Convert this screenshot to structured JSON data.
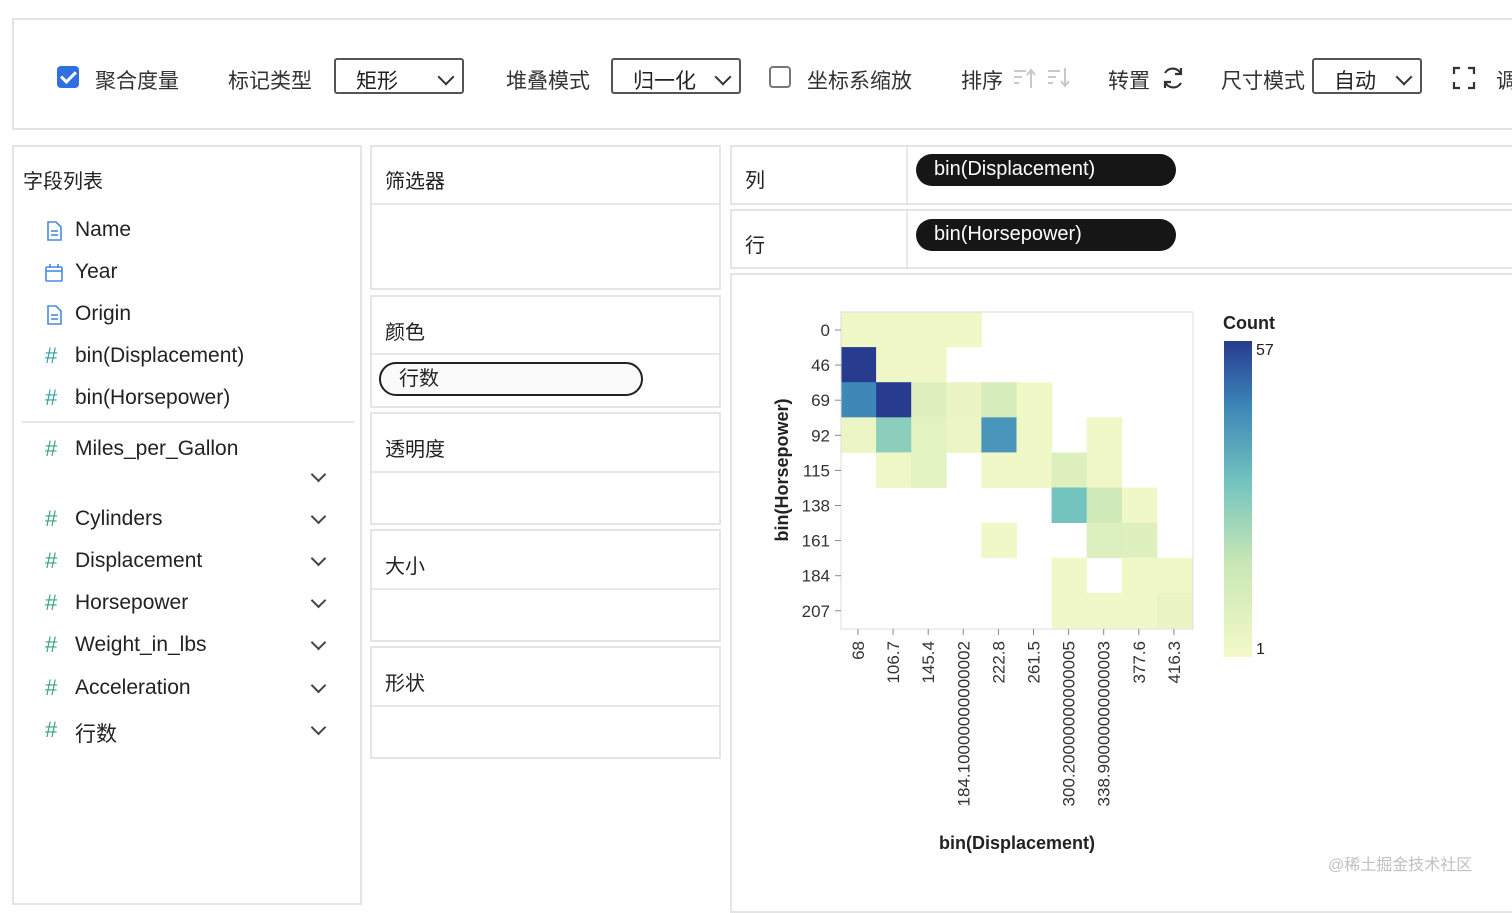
{
  "toolbar": {
    "aggregate_label": "聚合度量",
    "aggregate_checked": true,
    "mark_type_label": "标记类型",
    "mark_type_value": "矩形",
    "stack_label": "堆叠模式",
    "stack_value": "归一化",
    "axis_scale_label": "坐标系缩放",
    "axis_scale_checked": false,
    "sort_label": "排序",
    "transpose_label": "转置",
    "size_mode_label": "尺寸模式",
    "size_mode_value": "自动",
    "cut_label": "调"
  },
  "fields": {
    "title": "字段列表",
    "dimensions": [
      {
        "label": "Name",
        "icon": "file-icon"
      },
      {
        "label": "Year",
        "icon": "calendar-icon"
      },
      {
        "label": "Origin",
        "icon": "file-icon"
      },
      {
        "label": "bin(Displacement)",
        "icon": "hash-icon"
      },
      {
        "label": "bin(Horsepower)",
        "icon": "hash-icon"
      }
    ],
    "measures": [
      {
        "label": "Miles_per_Gallon"
      },
      {
        "label": "Cylinders"
      },
      {
        "label": "Displacement"
      },
      {
        "label": "Horsepower"
      },
      {
        "label": "Weight_in_lbs"
      },
      {
        "label": "Acceleration"
      },
      {
        "label": "行数"
      }
    ]
  },
  "encodings": {
    "filter": "筛选器",
    "color": "颜色",
    "color_field": "行数",
    "opacity": "透明度",
    "size": "大小",
    "shape": "形状"
  },
  "shelves": {
    "column_label": "列",
    "column_field": "bin(Displacement)",
    "row_label": "行",
    "row_field": "bin(Horsepower)"
  },
  "chart_data": {
    "type": "heatmap",
    "xlabel": "bin(Displacement)",
    "ylabel": "bin(Horsepower)",
    "x_ticks": [
      "68",
      "106.7",
      "145.4",
      "184.10000000000002",
      "222.8",
      "261.5",
      "300.20000000000005",
      "338.90000000000003",
      "377.6",
      "416.3"
    ],
    "y_ticks": [
      "0",
      "46",
      "69",
      "92",
      "115",
      "138",
      "161",
      "184",
      "207"
    ],
    "legend_title": "Count",
    "legend_max": "57",
    "legend_min": "1",
    "color_low": "#f4f9c8",
    "color_high": "#283c8f",
    "cells": [
      {
        "x": 0,
        "y": 0,
        "count": 2
      },
      {
        "x": 1,
        "y": 0,
        "count": 2
      },
      {
        "x": 2,
        "y": 0,
        "count": 2
      },
      {
        "x": 3,
        "y": 0,
        "count": 2
      },
      {
        "x": 0,
        "y": 1,
        "count": 57
      },
      {
        "x": 1,
        "y": 1,
        "count": 2
      },
      {
        "x": 2,
        "y": 1,
        "count": 2
      },
      {
        "x": 0,
        "y": 2,
        "count": 45
      },
      {
        "x": 1,
        "y": 2,
        "count": 57
      },
      {
        "x": 2,
        "y": 2,
        "count": 9
      },
      {
        "x": 3,
        "y": 2,
        "count": 5
      },
      {
        "x": 4,
        "y": 2,
        "count": 12
      },
      {
        "x": 5,
        "y": 2,
        "count": 2
      },
      {
        "x": 0,
        "y": 3,
        "count": 4
      },
      {
        "x": 1,
        "y": 3,
        "count": 28
      },
      {
        "x": 2,
        "y": 3,
        "count": 8
      },
      {
        "x": 3,
        "y": 3,
        "count": 4
      },
      {
        "x": 4,
        "y": 3,
        "count": 42
      },
      {
        "x": 5,
        "y": 3,
        "count": 2
      },
      {
        "x": 7,
        "y": 3,
        "count": 2
      },
      {
        "x": 1,
        "y": 4,
        "count": 3
      },
      {
        "x": 2,
        "y": 4,
        "count": 8
      },
      {
        "x": 4,
        "y": 4,
        "count": 2
      },
      {
        "x": 5,
        "y": 4,
        "count": 2
      },
      {
        "x": 6,
        "y": 4,
        "count": 9
      },
      {
        "x": 7,
        "y": 4,
        "count": 2
      },
      {
        "x": 6,
        "y": 5,
        "count": 32
      },
      {
        "x": 7,
        "y": 5,
        "count": 15
      },
      {
        "x": 8,
        "y": 5,
        "count": 2
      },
      {
        "x": 4,
        "y": 6,
        "count": 2
      },
      {
        "x": 7,
        "y": 6,
        "count": 10
      },
      {
        "x": 8,
        "y": 6,
        "count": 9
      },
      {
        "x": 6,
        "y": 7,
        "count": 2
      },
      {
        "x": 8,
        "y": 7,
        "count": 2
      },
      {
        "x": 9,
        "y": 7,
        "count": 2
      },
      {
        "x": 6,
        "y": 8,
        "count": 2
      },
      {
        "x": 7,
        "y": 8,
        "count": 2
      },
      {
        "x": 8,
        "y": 8,
        "count": 2
      },
      {
        "x": 9,
        "y": 8,
        "count": 5
      }
    ]
  },
  "watermark": "@稀土掘金技术社区"
}
